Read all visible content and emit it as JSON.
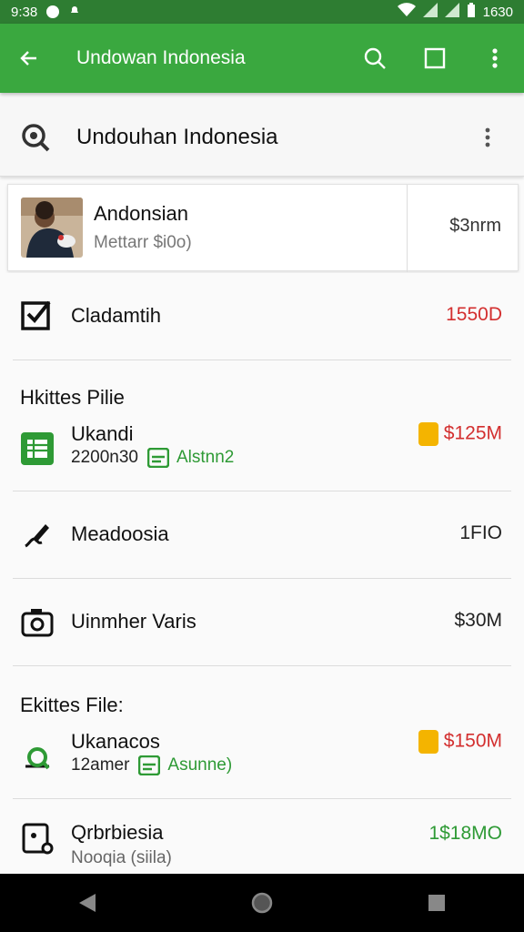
{
  "status_bar": {
    "time": "9:38",
    "clock": "1630"
  },
  "app_bar": {
    "title": "Undowan Indonesia"
  },
  "search_card": {
    "title": "Undouhan Indonesia"
  },
  "top_item": {
    "title": "Andonsian",
    "subtitle": "Mettarr $i0o)",
    "amount": "$3nrm"
  },
  "rows": {
    "r1": {
      "label": "Cladamtih",
      "value": "1550D",
      "icon": "checkbox-icon"
    },
    "section1": {
      "header": "Hkittes Pilie",
      "label": "Ukandi",
      "sub": "2200n30",
      "badge": "Alstnn2",
      "value": "$125M",
      "icon": "spreadsheet-icon"
    },
    "r3": {
      "label": "Meadoosia",
      "value": "1FIO",
      "icon": "pen-icon"
    },
    "r4": {
      "label": "Uinmher Varis",
      "value": "$30M",
      "icon": "camera-icon"
    },
    "section2": {
      "header": "Ekittes File:",
      "label": "Ukanacos",
      "sub": "12amer",
      "badge": "Asunne)",
      "value": "$150M",
      "icon": "cloud-sync-icon"
    },
    "r6": {
      "label": "Qrbrbiesia",
      "sub": "Nooqia (siila)",
      "value": "1$18MO",
      "icon": "clipboard-icon"
    }
  },
  "colors": {
    "appbar": "#3aa83f",
    "statusbar": "#2e7d32",
    "red": "#d32f2f",
    "green": "#2e9a35",
    "coin": "#f4b400"
  }
}
